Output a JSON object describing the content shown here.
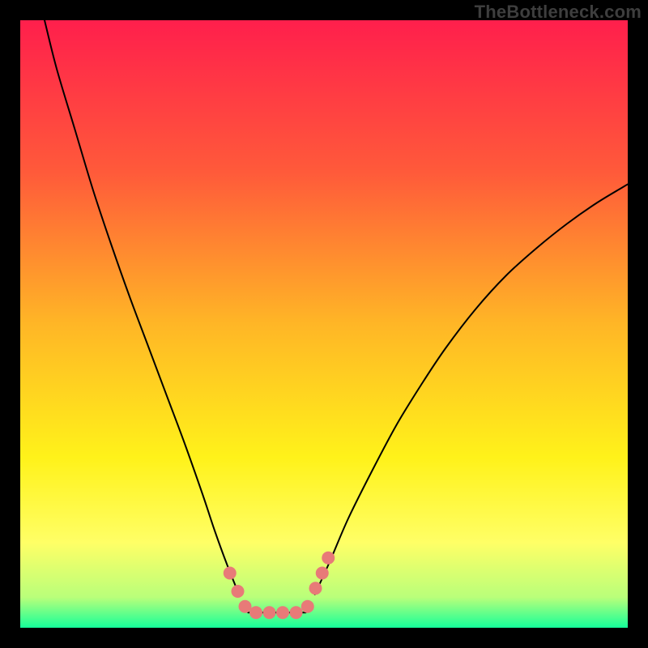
{
  "watermark": "TheBottleneck.com",
  "chart_data": {
    "type": "line",
    "title": "",
    "xlabel": "",
    "ylabel": "",
    "xlim": [
      0,
      100
    ],
    "ylim": [
      0,
      100
    ],
    "background_gradient": {
      "stops": [
        {
          "offset": 0.0,
          "color": "#ff1f4c"
        },
        {
          "offset": 0.25,
          "color": "#ff5a3a"
        },
        {
          "offset": 0.5,
          "color": "#ffb626"
        },
        {
          "offset": 0.72,
          "color": "#fff21a"
        },
        {
          "offset": 0.86,
          "color": "#ffff66"
        },
        {
          "offset": 0.95,
          "color": "#b9ff7a"
        },
        {
          "offset": 1.0,
          "color": "#15ff9a"
        }
      ]
    },
    "series": [
      {
        "name": "curve-left",
        "color": "#000000",
        "width": 2,
        "points": [
          {
            "x": 4.0,
            "y": 100.0
          },
          {
            "x": 6.0,
            "y": 92.0
          },
          {
            "x": 9.0,
            "y": 82.0
          },
          {
            "x": 12.0,
            "y": 72.0
          },
          {
            "x": 15.0,
            "y": 63.0
          },
          {
            "x": 18.0,
            "y": 54.5
          },
          {
            "x": 21.0,
            "y": 46.5
          },
          {
            "x": 24.0,
            "y": 38.5
          },
          {
            "x": 27.0,
            "y": 30.5
          },
          {
            "x": 30.0,
            "y": 22.0
          },
          {
            "x": 32.0,
            "y": 16.0
          },
          {
            "x": 34.0,
            "y": 10.5
          },
          {
            "x": 36.0,
            "y": 5.5
          }
        ]
      },
      {
        "name": "curve-right",
        "color": "#000000",
        "width": 2,
        "points": [
          {
            "x": 48.5,
            "y": 5.5
          },
          {
            "x": 51.0,
            "y": 11.0
          },
          {
            "x": 54.0,
            "y": 18.0
          },
          {
            "x": 58.0,
            "y": 26.0
          },
          {
            "x": 62.0,
            "y": 33.5
          },
          {
            "x": 66.0,
            "y": 40.0
          },
          {
            "x": 70.0,
            "y": 46.0
          },
          {
            "x": 75.0,
            "y": 52.5
          },
          {
            "x": 80.0,
            "y": 58.0
          },
          {
            "x": 85.0,
            "y": 62.5
          },
          {
            "x": 90.0,
            "y": 66.5
          },
          {
            "x": 95.0,
            "y": 70.0
          },
          {
            "x": 100.0,
            "y": 73.0
          }
        ]
      },
      {
        "name": "flat-bottom",
        "color": "#000000",
        "width": 2,
        "points": [
          {
            "x": 37.5,
            "y": 2.5
          },
          {
            "x": 47.0,
            "y": 2.5
          }
        ]
      }
    ],
    "markers": [
      {
        "name": "fit-points",
        "color": "#e87a78",
        "radius": 8,
        "points": [
          {
            "x": 34.5,
            "y": 9.0
          },
          {
            "x": 35.8,
            "y": 6.0
          },
          {
            "x": 37.0,
            "y": 3.5
          },
          {
            "x": 38.8,
            "y": 2.5
          },
          {
            "x": 41.0,
            "y": 2.5
          },
          {
            "x": 43.2,
            "y": 2.5
          },
          {
            "x": 45.4,
            "y": 2.5
          },
          {
            "x": 47.3,
            "y": 3.5
          },
          {
            "x": 48.6,
            "y": 6.5
          },
          {
            "x": 49.7,
            "y": 9.0
          },
          {
            "x": 50.7,
            "y": 11.5
          }
        ]
      }
    ]
  }
}
